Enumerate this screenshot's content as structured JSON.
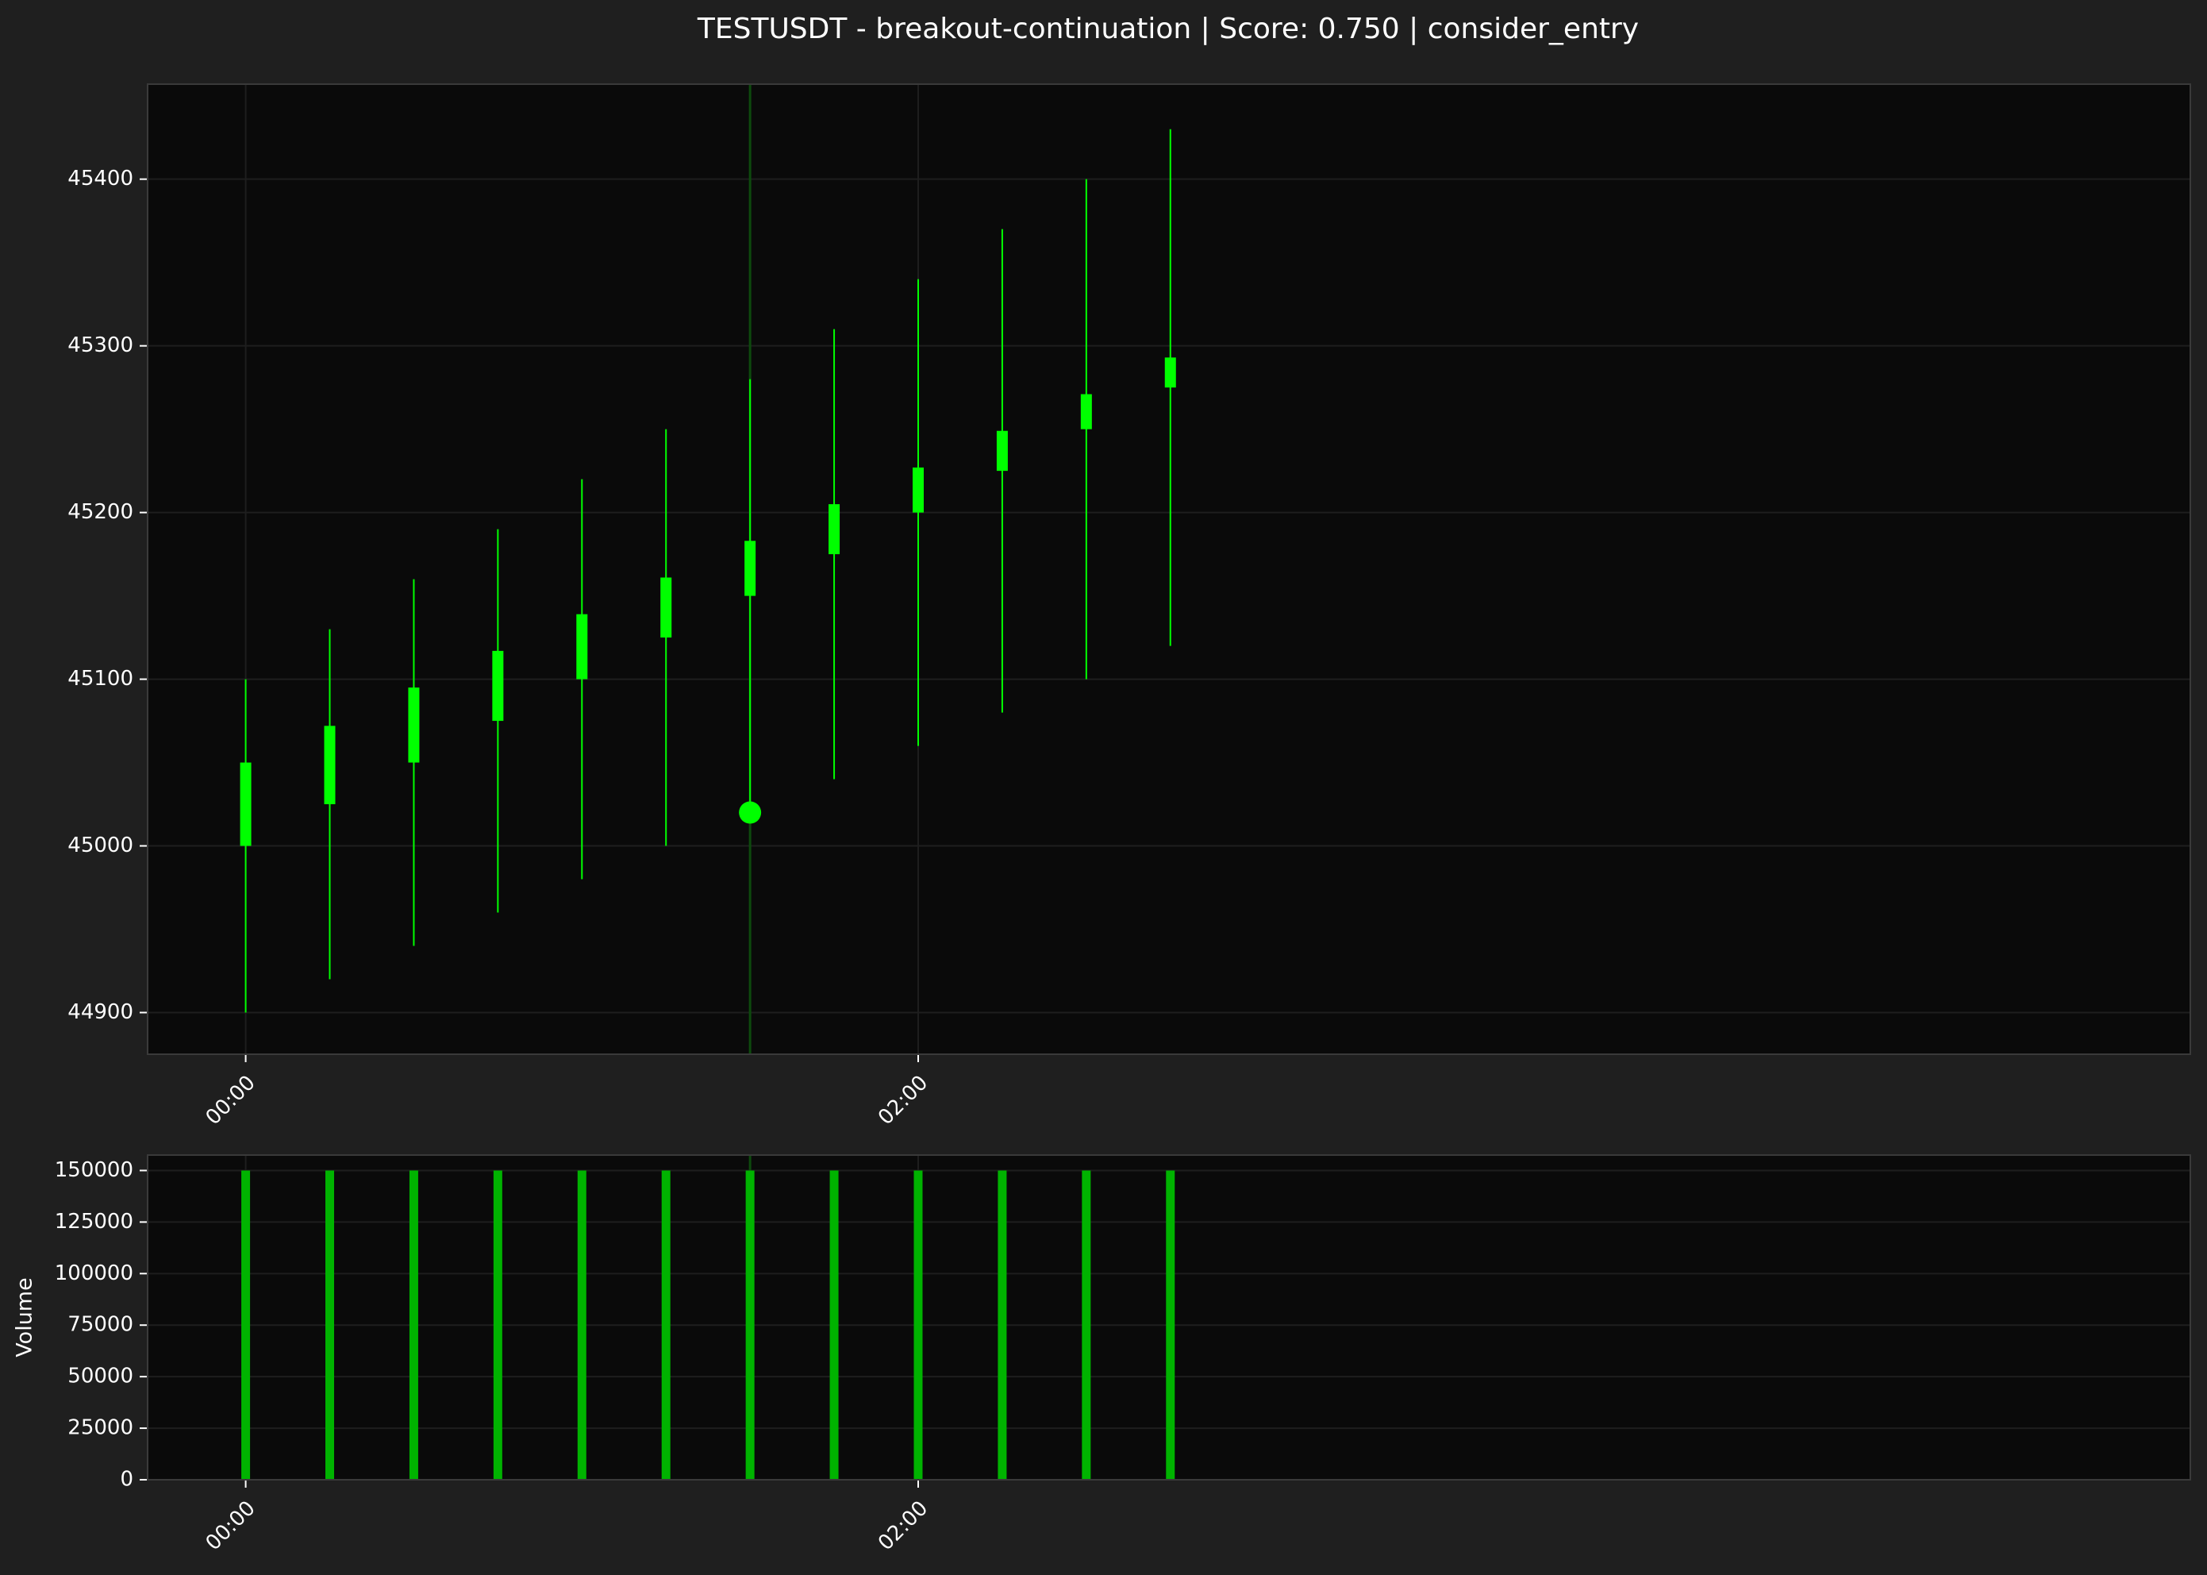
{
  "title": "TESTUSDT - breakout-continuation | Score: 0.750 | consider_entry",
  "colors": {
    "figure_bg": "#1f1f1f",
    "axes_bg": "#0a0a0a",
    "spine": "#3a3a3a",
    "grid": "#1e1e1e",
    "text": "#ffffff",
    "candle_up": "#00ff00",
    "volume_bar": "#00b300",
    "marker": "#00ff00",
    "vline": "#0d4a0d"
  },
  "chart_data": [
    {
      "type": "candlestick",
      "title": "TESTUSDT - breakout-continuation | Score: 0.750 | consider_entry",
      "xlabel": "",
      "ylabel": "",
      "ylim": [
        44875,
        45457
      ],
      "xlim_minutes": [
        -17.5,
        347
      ],
      "yticks": [
        44900,
        45000,
        45100,
        45200,
        45300,
        45400
      ],
      "xticks": [
        {
          "t": 0,
          "label": "00:00"
        },
        {
          "t": 120,
          "label": "02:00"
        }
      ],
      "grid": true,
      "interval_minutes": 15,
      "candles": [
        {
          "t": "00:00",
          "open": 45000,
          "high": 45100,
          "low": 44900,
          "close": 45050
        },
        {
          "t": "00:15",
          "open": 45025,
          "high": 45130,
          "low": 44920,
          "close": 45072
        },
        {
          "t": "00:30",
          "open": 45050,
          "high": 45160,
          "low": 44940,
          "close": 45095
        },
        {
          "t": "00:45",
          "open": 45075,
          "high": 45190,
          "low": 44960,
          "close": 45117
        },
        {
          "t": "01:00",
          "open": 45100,
          "high": 45220,
          "low": 44980,
          "close": 45139
        },
        {
          "t": "01:15",
          "open": 45125,
          "high": 45250,
          "low": 45000,
          "close": 45161
        },
        {
          "t": "01:30",
          "open": 45150,
          "high": 45280,
          "low": 45020,
          "close": 45183
        },
        {
          "t": "01:45",
          "open": 45175,
          "high": 45310,
          "low": 45040,
          "close": 45205
        },
        {
          "t": "02:00",
          "open": 45200,
          "high": 45340,
          "low": 45060,
          "close": 45227
        },
        {
          "t": "02:15",
          "open": 45225,
          "high": 45370,
          "low": 45080,
          "close": 45249
        },
        {
          "t": "02:30",
          "open": 45250,
          "high": 45400,
          "low": 45100,
          "close": 45271
        },
        {
          "t": "02:45",
          "open": 45275,
          "high": 45430,
          "low": 45120,
          "close": 45293
        }
      ],
      "markers": [
        {
          "t": "01:30",
          "price": 45020
        }
      ],
      "vlines": [
        "01:30"
      ]
    },
    {
      "type": "bar",
      "title": "",
      "xlabel": "",
      "ylabel": "Volume",
      "ylim": [
        0,
        157500
      ],
      "yticks": [
        0,
        25000,
        50000,
        75000,
        100000,
        125000,
        150000
      ],
      "xticks": [
        {
          "t": 0,
          "label": "00:00"
        },
        {
          "t": 120,
          "label": "02:00"
        }
      ],
      "grid": true,
      "categories": [
        "00:00",
        "00:15",
        "00:30",
        "00:45",
        "01:00",
        "01:15",
        "01:30",
        "01:45",
        "02:00",
        "02:15",
        "02:30",
        "02:45"
      ],
      "values": [
        150000,
        150000,
        150000,
        150000,
        150000,
        150000,
        150000,
        150000,
        150000,
        150000,
        150000,
        150000
      ]
    }
  ]
}
